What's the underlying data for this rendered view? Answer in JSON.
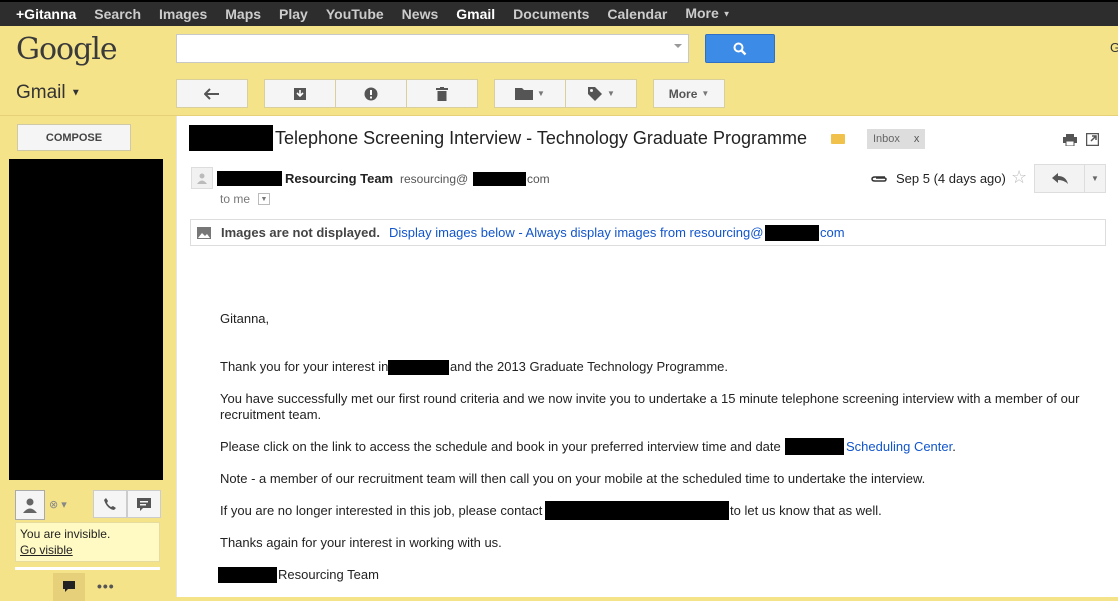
{
  "topnav": {
    "items": [
      "+Gitanna",
      "Search",
      "Images",
      "Maps",
      "Play",
      "YouTube",
      "News",
      "Gmail",
      "Documents",
      "Calendar",
      "More"
    ],
    "active": "Gmail"
  },
  "header": {
    "logo": "Google",
    "search_value": "",
    "right_text": "G"
  },
  "gmail": {
    "label": "Gmail",
    "toolbar": {
      "more_label": "More"
    }
  },
  "left": {
    "compose_label": "COMPOSE",
    "invisible_text": "You are invisible.",
    "go_visible": "Go visible"
  },
  "message": {
    "subject": "Telephone Screening Interview - Technology Graduate Programme",
    "label_chip": "Inbox",
    "label_chip_close": "x",
    "sender_name": "Resourcing Team",
    "sender_email_prefix": "resourcing@",
    "sender_email_suffix": "com",
    "to": "to me",
    "date": "Sep 5 (4 days ago)",
    "images_notice": {
      "bold": "Images are not displayed.",
      "link": "Display images below - Always display images from resourcing@",
      "suffix": "com"
    },
    "body": {
      "greeting": "Gitanna,",
      "p1_a": "Thank you for your interest in",
      "p1_b": "and the 2013 Graduate Technology Programme.",
      "p2_l1": "You have successfully met our first round criteria and we now invite you to undertake a 15 minute telephone screening interview with a member of our",
      "p2_l2": "recruitment team.",
      "p3_a": "Please click on the link to access the schedule and book in your preferred interview time and date",
      "p3_link": "Scheduling Center",
      "p3_end": ".",
      "p4": "Note - a member of our recruitment team will then call you on your mobile at the scheduled time to undertake the interview.",
      "p5_a": "If you are no longer interested in this job, please contact",
      "p5_b": "to let us know that as well.",
      "p6": "Thanks again for your interest in working with us.",
      "sign": "Resourcing Team"
    }
  },
  "colors": {
    "theme_yellow": "#f5e38a",
    "topbar": "#2d2d2d",
    "search_blue": "#3c8be6",
    "link_blue": "#1155cc"
  }
}
